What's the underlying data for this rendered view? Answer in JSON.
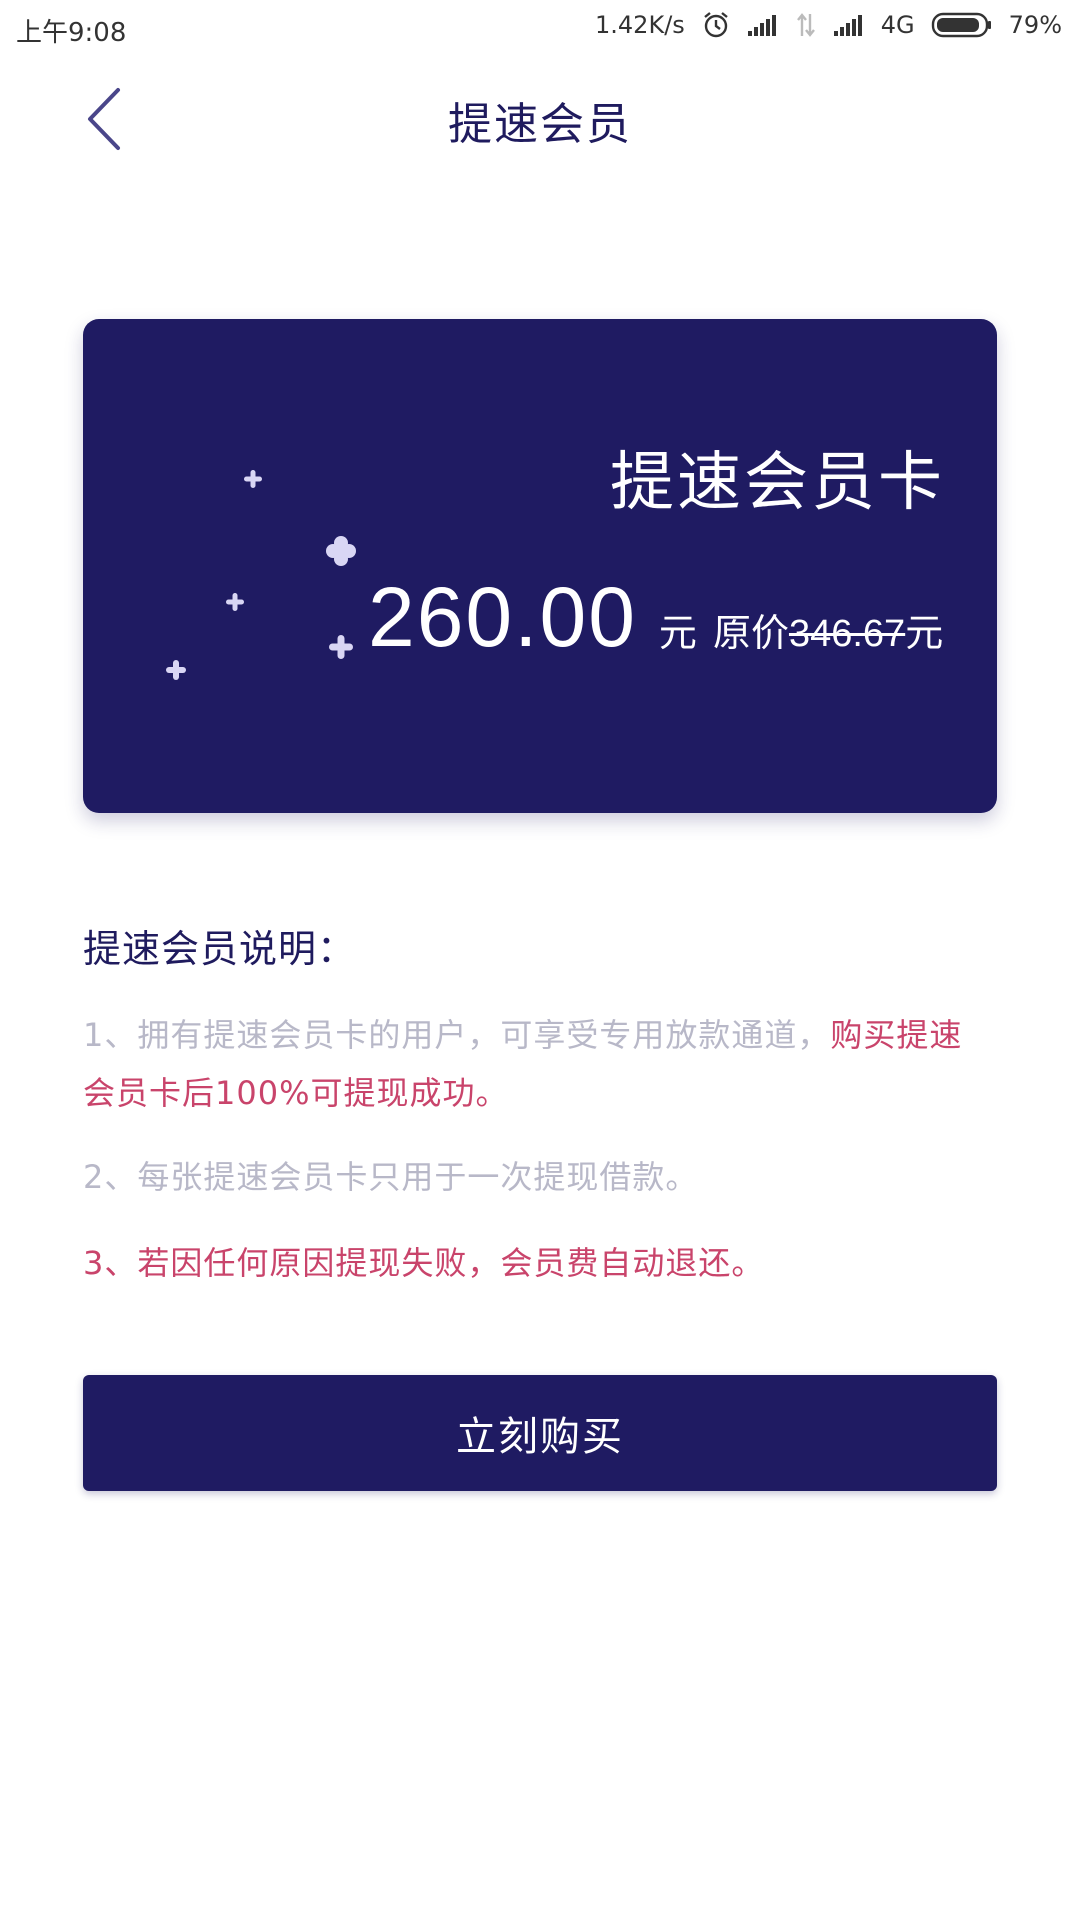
{
  "status_bar": {
    "time": "上午9:08",
    "network_speed": "1.42K/s",
    "network_type": "4G",
    "battery": "79%",
    "icons": [
      "alarm-icon",
      "signal-icon",
      "data-arrows-icon",
      "signal-icon",
      "battery-icon"
    ]
  },
  "nav": {
    "back_icon": "chevron-left-icon",
    "title": "提速会员"
  },
  "card": {
    "title": "提速会员卡",
    "price": "260.00",
    "price_unit": "元",
    "original_label": "原价",
    "original_price": "346.67",
    "original_unit": "元",
    "background_color": "#1f1b62",
    "decoration": "sparkle-icon"
  },
  "description": {
    "title": "提速会员说明：",
    "item1_normal": "1、拥有提速会员卡的用户，可享受专用放款通道，",
    "item1_highlight": "购买提速会员卡后100%可提现成功。",
    "item2": "2、每张提速会员卡只用于一次提现借款。",
    "item3": "3、若因任何原因提现失败，会员费自动退还。",
    "highlight_color": "#c9446b",
    "muted_color": "#b8b8c8"
  },
  "buy_button": {
    "label": "立刻购买",
    "color": "#1f1b62"
  }
}
